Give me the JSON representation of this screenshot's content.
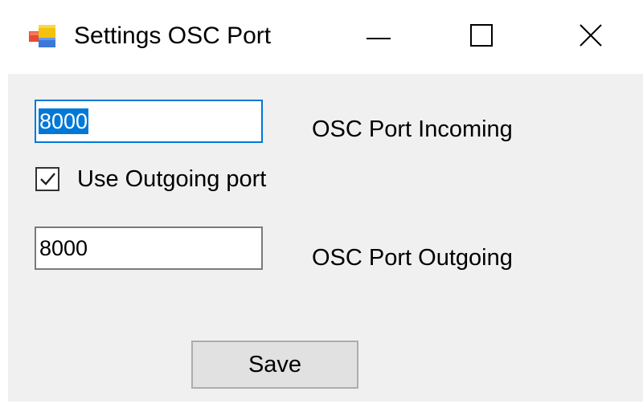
{
  "window": {
    "title": "Settings OSC Port",
    "icon": "app-window-icon",
    "controls": {
      "minimize_icon": "minimize-icon",
      "maximize_icon": "maximize-icon",
      "close_icon": "close-icon"
    }
  },
  "form": {
    "incoming": {
      "value": "8000",
      "selected": true,
      "label": "OSC Port Incoming"
    },
    "use_outgoing": {
      "checked": true,
      "label": "Use Outgoing port"
    },
    "outgoing": {
      "value": "8000",
      "label": "OSC Port Outgoing"
    },
    "save_label": "Save"
  },
  "colors": {
    "accent": "#0078d7",
    "client_bg": "#f0f0f0",
    "button_bg": "#e1e1e1"
  }
}
